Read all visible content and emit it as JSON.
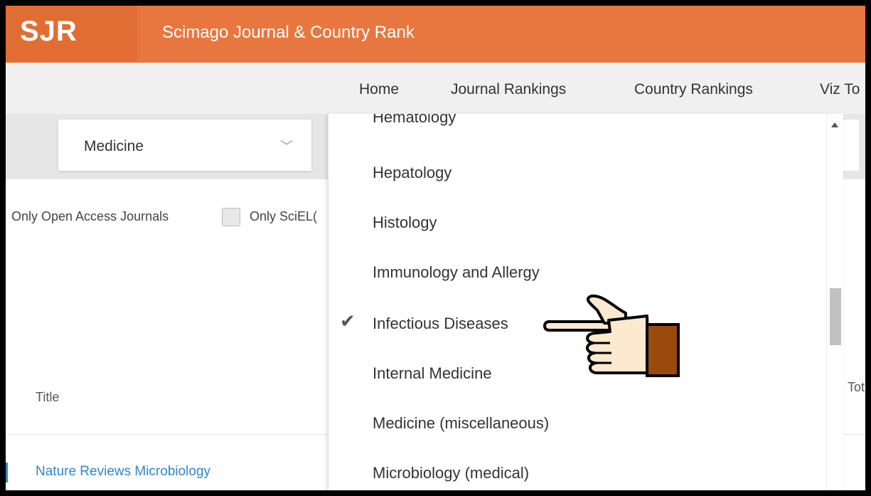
{
  "header": {
    "logo": "SJR",
    "site_name": "Scimago Journal & Country Rank"
  },
  "nav": {
    "items": [
      "Home",
      "Journal Rankings",
      "Country Rankings",
      "Viz To"
    ],
    "active": "Journal Rankings"
  },
  "filter": {
    "subject_area": "Medicine"
  },
  "options": {
    "open_access": "Only Open Access Journals",
    "scielo": "Only SciEL("
  },
  "table": {
    "title_header": "Title",
    "total_header": "Tot",
    "first_row": "Nature Reviews Microbiology"
  },
  "dropdown": {
    "partial_top": "Hematology",
    "items": [
      "Hepatology",
      "Histology",
      "Immunology and Allergy",
      "Infectious Diseases",
      "Internal Medicine",
      "Medicine (miscellaneous)",
      "Microbiology (medical)"
    ],
    "selected": "Infectious Diseases"
  },
  "colors": {
    "brand": "#e8773f",
    "link": "#2f86c8",
    "hand_skin": "#fde9cf",
    "hand_cuff": "#9a4a0c"
  },
  "icons": {
    "dropdown": "chevron-down-icon",
    "selected": "checkmark-icon",
    "pointer": "pointing-hand-icon"
  }
}
